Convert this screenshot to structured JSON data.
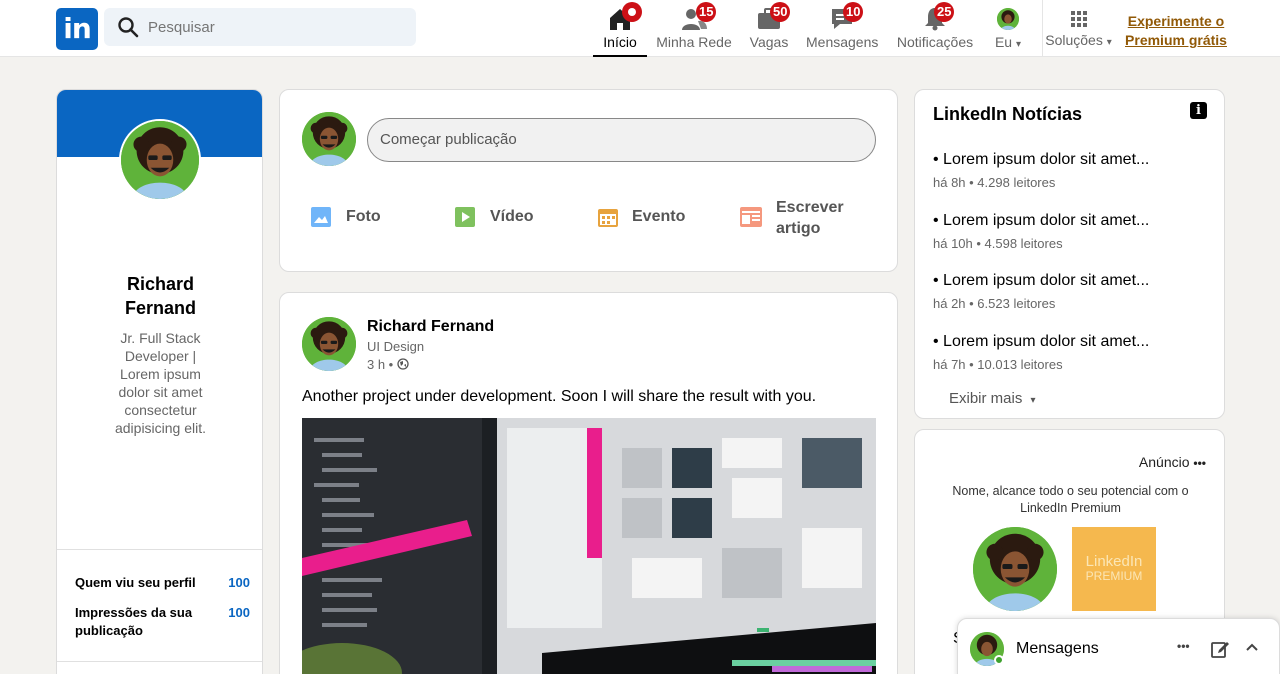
{
  "header": {
    "logo_text": "in",
    "search_placeholder": "Pesquisar",
    "nav": [
      {
        "label": "Início",
        "badge": ""
      },
      {
        "label": "Minha Rede",
        "badge": "15"
      },
      {
        "label": "Vagas",
        "badge": "50"
      },
      {
        "label": "Mensagens",
        "badge": "10"
      },
      {
        "label": "Notificações",
        "badge": "25"
      },
      {
        "label": "Eu",
        "caret": "▾"
      },
      {
        "label": "Soluções",
        "caret": "▾"
      }
    ],
    "premium_line1": "Experimente o",
    "premium_line2": "Premium grátis"
  },
  "profile": {
    "name_line1": "Richard",
    "name_line2": "Fernand",
    "headline_lines": [
      "Jr. Full Stack",
      "Developer |",
      "Lorem ipsum",
      "dolor sit amet",
      "consectetur",
      "adipisicing elit."
    ],
    "stats": [
      {
        "label_line1": "Quem viu seu perfil",
        "label_line2": "",
        "value": "100"
      },
      {
        "label_line1": "Impressões da sua",
        "label_line2": "publicação",
        "value": "100"
      }
    ]
  },
  "composer": {
    "placeholder": "Começar publicação",
    "actions": [
      {
        "label": "Foto",
        "icon": "photo-icon",
        "color": "#70b5f9"
      },
      {
        "label": "Vídeo",
        "icon": "video-icon",
        "color": "#7fc15e"
      },
      {
        "label": "Evento",
        "icon": "calendar-icon",
        "color": "#e7a33e"
      },
      {
        "label_line1": "Escrever",
        "label_line2": "artigo",
        "icon": "article-icon",
        "color": "#f5987e"
      }
    ]
  },
  "post": {
    "author": "Richard Fernand",
    "subtitle": "UI Design",
    "time": "3 h •",
    "text": "Another project under development. Soon I will share the result with you."
  },
  "news": {
    "title": "LinkedIn Notícias",
    "items": [
      {
        "title": "• Lorem ipsum dolor sit amet...",
        "meta": "há 8h • 4.298 leitores"
      },
      {
        "title": "• Lorem ipsum dolor sit amet...",
        "meta": "há 10h • 4.598 leitores"
      },
      {
        "title": "• Lorem ipsum dolor sit amet...",
        "meta": "há 2h • 6.523 leitores"
      },
      {
        "title": "• Lorem ipsum dolor sit amet...",
        "meta": "há 7h • 10.013 leitores"
      }
    ],
    "show_more": "Exibir mais",
    "show_more_caret": "▾"
  },
  "ad": {
    "label": "Anúncio",
    "more": "•••",
    "text_line1": "Nome, alcance todo o seu potencial com o",
    "text_line2": "LinkedIn Premium",
    "premium_logo_line1": "LinkedIn",
    "premium_logo_line2": "PREMIUM",
    "partial_char": "S"
  },
  "messaging": {
    "title": "Mensagens",
    "more": "•••"
  },
  "colors": {
    "brand": "#0a66c2",
    "badge": "#cc1016",
    "premium": "#915907",
    "stat_value": "#0a66c2"
  }
}
